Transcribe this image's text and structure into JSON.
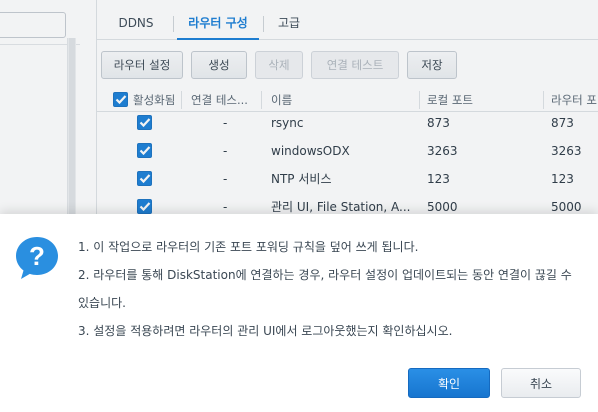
{
  "tabs": [
    {
      "label": "DDNS",
      "active": false
    },
    {
      "label": "라우터 구성",
      "active": true
    },
    {
      "label": "고급",
      "active": false
    }
  ],
  "toolbar": {
    "router_settings": "라우터 설정",
    "create": "생성",
    "delete": "삭제",
    "test_connection": "연결 테스트",
    "save": "저장"
  },
  "grid": {
    "columns": [
      "활성화됨",
      "연결 테스...",
      "이름",
      "로컬 포트",
      "라우터 포"
    ],
    "rows": [
      {
        "enabled": true,
        "test": "-",
        "name": "rsync",
        "local_port": "873",
        "router_port": "873"
      },
      {
        "enabled": true,
        "test": "-",
        "name": "windowsODX",
        "local_port": "3263",
        "router_port": "3263"
      },
      {
        "enabled": true,
        "test": "-",
        "name": "NTP 서비스",
        "local_port": "123",
        "router_port": "123"
      },
      {
        "enabled": true,
        "test": "-",
        "name": "관리 UI, File Station, A...",
        "local_port": "5000",
        "router_port": "5000"
      }
    ]
  },
  "dialog": {
    "icon": "question-icon",
    "lines": [
      "1. 이 작업으로 라우터의 기존 포트 포워딩 규칙을 덮어 쓰게 됩니다.",
      "2. 라우터를 통해 DiskStation에 연결하는 경우, 라우터 설정이 업데이트되는 동안 연결이 끊길 수",
      "있습니다.",
      "3. 설정을 적용하려면 라우터의 관리 UI에서 로그아웃했는지 확인하십시오."
    ],
    "ok_label": "확인",
    "cancel_label": "취소"
  },
  "colors": {
    "accent": "#1a7fd8",
    "icon_blue": "#2a8fe0"
  }
}
